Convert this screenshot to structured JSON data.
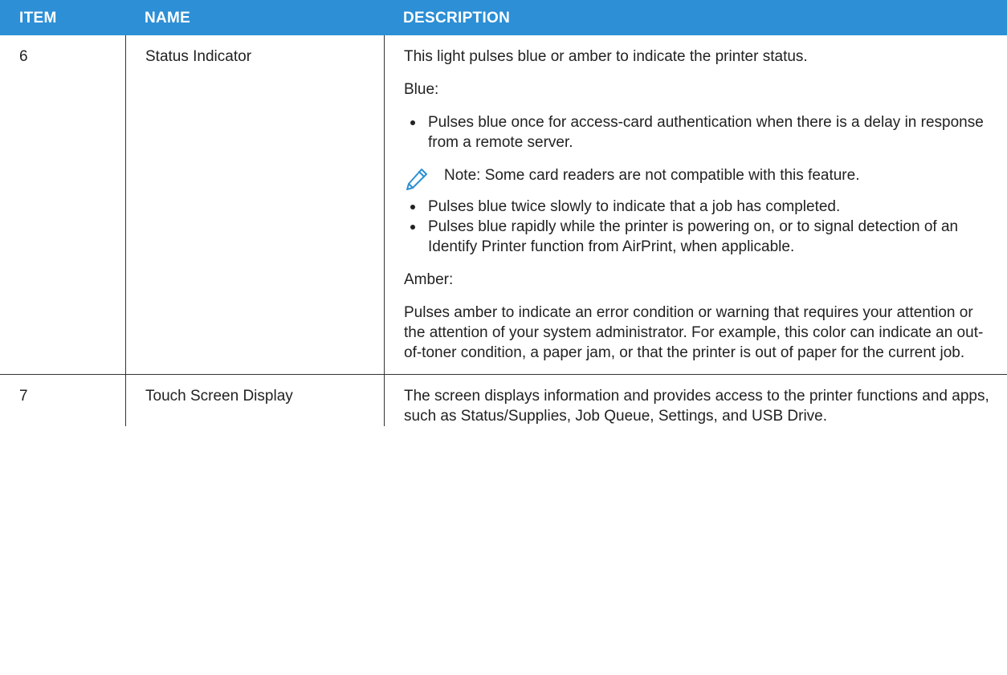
{
  "table": {
    "headers": {
      "item": "ITEM",
      "name": "NAME",
      "description": "DESCRIPTION"
    },
    "rows": [
      {
        "item": "6",
        "name": "Status Indicator",
        "intro": "This light pulses blue or amber to indicate the printer status.",
        "blue_label": "Blue:",
        "blue_bullet_1": "Pulses blue once for access-card authentication when there is a delay in response from a remote server.",
        "note_icon": "pencil-icon",
        "note": "Note: Some card readers are not compatible with this feature.",
        "blue_bullet_2": "Pulses blue twice slowly to indicate that a job has completed.",
        "blue_bullet_3": "Pulses blue rapidly while the printer is powering on, or to signal detection of an Identify Printer function from AirPrint, when applicable.",
        "amber_label": "Amber:",
        "amber_text": "Pulses amber to indicate an error condition or warning that requires your attention or the attention of your system administrator. For example, this color can indicate an out-of-toner condition, a paper jam, or that the printer is out of paper for the current job."
      },
      {
        "item": "7",
        "name": "Touch Screen Display",
        "description": "The screen displays information and provides access to the printer functions and apps, such as Status/Supplies, Job Queue, Settings, and USB Drive."
      }
    ]
  },
  "colors": {
    "header_bg": "#2d8fd5",
    "header_text": "#ffffff",
    "note_icon": "#2d8fd5"
  }
}
